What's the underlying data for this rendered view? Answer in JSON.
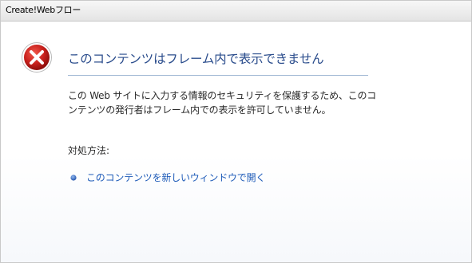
{
  "window": {
    "title": "Create!Webフロー"
  },
  "error": {
    "icon": "error-x-icon",
    "heading": "このコンテンツはフレーム内で表示できません",
    "description_lines": [
      "この Web サイトに入力する情報のセキュリティを保護するため、このコ",
      "ンテンツの発行者はフレーム内での表示を許可していません。"
    ],
    "remedy_title": "対処方法:",
    "remedy_link": "このコンテンツを新しいウィンドウで開く"
  },
  "colors": {
    "heading": "#2a4c8c",
    "link": "#1e5bb8",
    "icon_red": "#c8201c"
  }
}
